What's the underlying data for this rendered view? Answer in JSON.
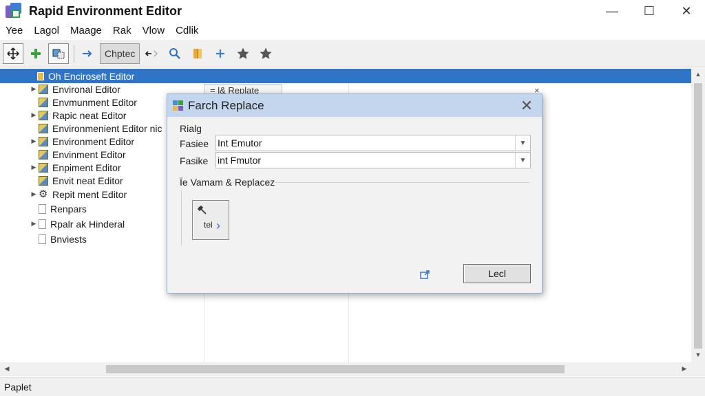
{
  "window": {
    "title": "Rapid Environment Editor",
    "minimize": "—",
    "maximize": "☐",
    "close": "✕"
  },
  "menu": [
    "Yee",
    "Lagol",
    "Maage",
    "Rak",
    "Vlow",
    "Cdlik"
  ],
  "toolbar": {
    "pressed_label": "Chptec",
    "icons": [
      "move-icon",
      "add-icon",
      "select-icon",
      "arrow-right-icon",
      "back-icon",
      "search-icon",
      "book-icon",
      "plus-icon",
      "star-icon",
      "star-icon"
    ]
  },
  "tree": {
    "items": [
      {
        "label": "Oh Enciroseft Editor",
        "expander": "",
        "icon": "folder",
        "selected": true
      },
      {
        "label": "Environal Editor",
        "expander": "▶",
        "icon": "env"
      },
      {
        "label": "Envmunment Editor",
        "expander": "",
        "icon": "env"
      },
      {
        "label": "Rapic neat Editor",
        "expander": "▶",
        "icon": "env"
      },
      {
        "label": "Environmenient Editor nic",
        "expander": "",
        "icon": "env"
      },
      {
        "label": "Environment Editor",
        "expander": "▶",
        "icon": "env"
      },
      {
        "label": "Envinment Editor",
        "expander": "",
        "icon": "env"
      },
      {
        "label": "Enpiment Editor",
        "expander": "▶",
        "icon": "env"
      },
      {
        "label": "Envit neat Editor",
        "expander": "",
        "icon": "env"
      },
      {
        "label": "Repit ment Editor",
        "expander": "▶",
        "icon": "gear"
      },
      {
        "label": "Renpars",
        "expander": "",
        "icon": "doc"
      },
      {
        "label": "Rpalr ak Hinderal",
        "expander": "▶",
        "icon": "doc"
      },
      {
        "label": "Bnviests",
        "expander": "",
        "icon": "doc"
      }
    ],
    "background_tab": "= l& Replate",
    "background_close": "×"
  },
  "status": {
    "text": "Paplet"
  },
  "dialog": {
    "title": "Farch Replace",
    "close": "✕",
    "section_label": "Rialg",
    "field1_label": "Fasiee",
    "field1_value": "Int Emutor",
    "field2_label": "Fasike",
    "field2_value": "int Fmutor",
    "dropdown_glyph": "▼",
    "group_label": "Ïe Vamam & Replacez",
    "tool_button_label": "tel",
    "ok_label": "Lecl"
  }
}
